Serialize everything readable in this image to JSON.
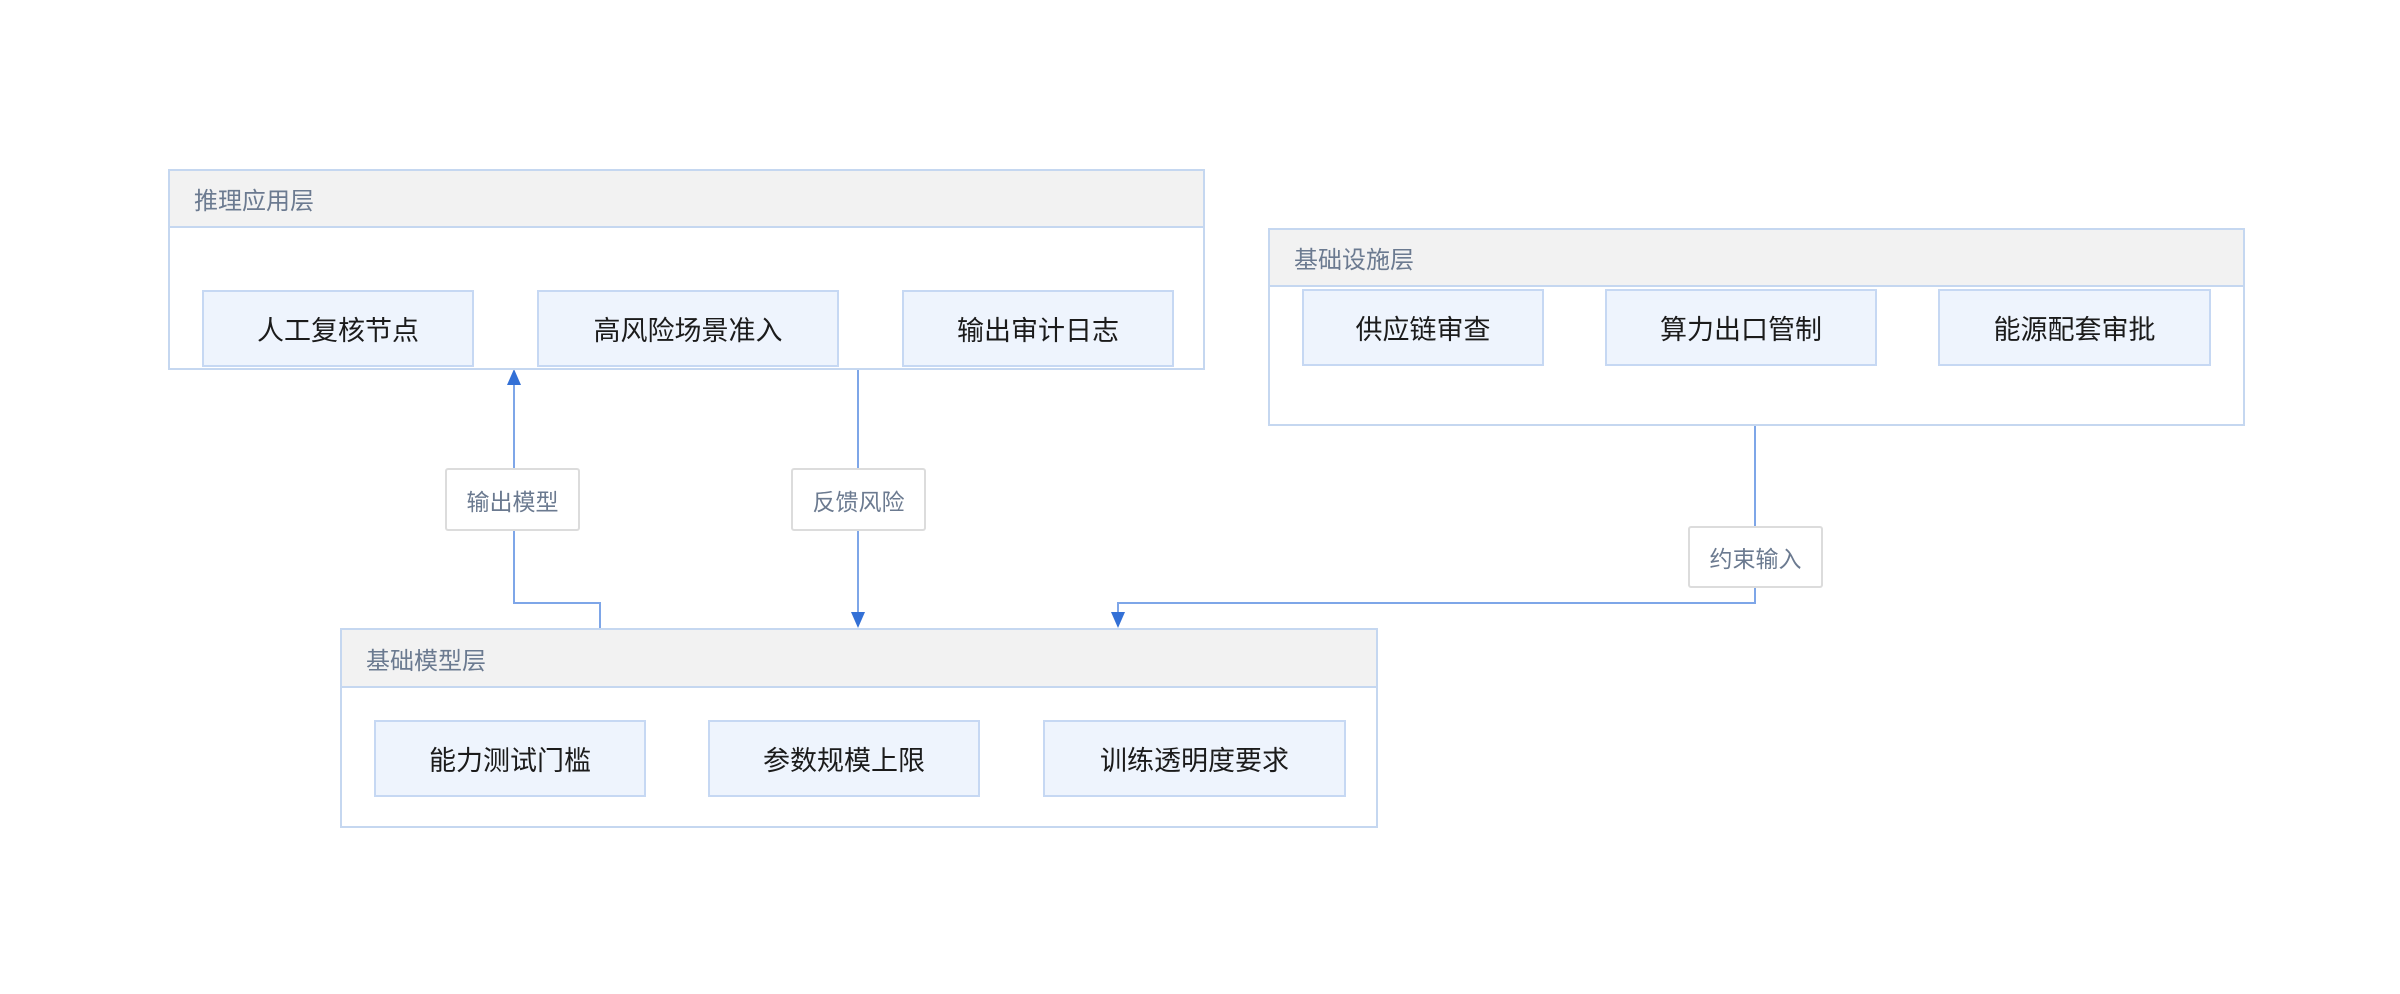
{
  "groups": {
    "inference": {
      "title": "推理应用层",
      "nodes": [
        "人工复核节点",
        "高风险场景准入",
        "输出审计日志"
      ]
    },
    "infrastructure": {
      "title": "基础设施层",
      "nodes": [
        "供应链审查",
        "算力出口管制",
        "能源配套审批"
      ]
    },
    "foundation": {
      "title": "基础模型层",
      "nodes": [
        "能力测试门槛",
        "参数规模上限",
        "训练透明度要求"
      ]
    }
  },
  "edges": [
    {
      "label": "输出模型"
    },
    {
      "label": "反馈风险"
    },
    {
      "label": "约束输入"
    }
  ],
  "colors": {
    "group-border": "#c5d7f0",
    "header-fill": "#f2f2f2",
    "node-fill": "#eef4fd",
    "node-border": "#c6d8f3",
    "edge-line": "#7ea6e8",
    "arrow": "#3370d6",
    "title-text": "#6b7a90",
    "node-text": "#1b1b1b",
    "label-border": "#dcdcdc"
  }
}
